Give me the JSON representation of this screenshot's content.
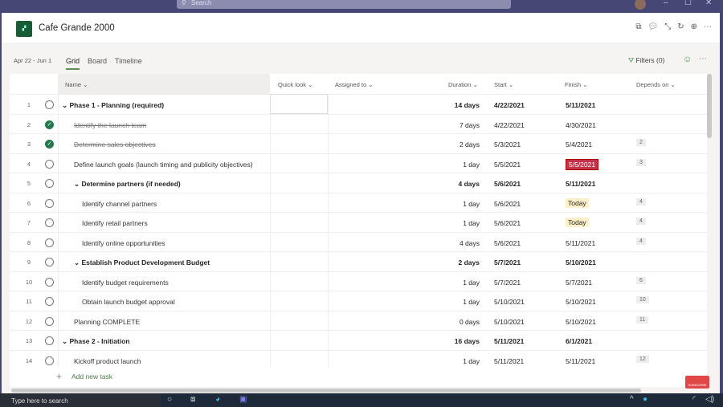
{
  "topbar": {
    "search_placeholder": "Search"
  },
  "app": {
    "title": "Cafe Grande 2000",
    "date_range": "Apr 22 - Jun 1"
  },
  "tabs": [
    {
      "label": "Grid",
      "active": true
    },
    {
      "label": "Board"
    },
    {
      "label": "Timeline"
    }
  ],
  "filters_label": "Filters (0)",
  "columns": {
    "name": "Name",
    "quick_look": "Quick look",
    "assigned_to": "Assigned to",
    "duration": "Duration",
    "start": "Start",
    "finish": "Finish",
    "depends_on": "Depends on"
  },
  "rows": [
    {
      "num": "1",
      "name": "Phase 1 - Planning (required)",
      "level": 0,
      "summary": true,
      "done": false,
      "duration": "14 days",
      "start": "4/22/2021",
      "finish": "5/11/2021",
      "depends": ""
    },
    {
      "num": "2",
      "name": "Identify the launch team",
      "level": 1,
      "done": true,
      "duration": "7 days",
      "start": "4/22/2021",
      "finish": "4/30/2021",
      "depends": ""
    },
    {
      "num": "3",
      "name": "Determine sales objectives",
      "level": 1,
      "done": true,
      "duration": "2 days",
      "start": "5/3/2021",
      "finish": "5/4/2021",
      "depends": "2"
    },
    {
      "num": "4",
      "name": "Define launch goals (launch timing and publicity objectives)",
      "level": 1,
      "done": false,
      "duration": "1 day",
      "start": "5/5/2021",
      "finish": "5/5/2021",
      "finish_status": "late",
      "depends": "3"
    },
    {
      "num": "5",
      "name": "Determine partners (if needed)",
      "level": 1,
      "summary": true,
      "done": false,
      "duration": "4 days",
      "start": "5/6/2021",
      "finish": "5/11/2021",
      "depends": ""
    },
    {
      "num": "6",
      "name": "Identify channel partners",
      "level": 2,
      "done": false,
      "duration": "1 day",
      "start": "5/6/2021",
      "finish": "Today",
      "finish_status": "today",
      "depends": "4"
    },
    {
      "num": "7",
      "name": "Identify retail partners",
      "level": 2,
      "done": false,
      "duration": "1 day",
      "start": "5/6/2021",
      "finish": "Today",
      "finish_status": "today",
      "depends": "4"
    },
    {
      "num": "8",
      "name": "Identify online opportunities",
      "level": 2,
      "done": false,
      "duration": "4 days",
      "start": "5/6/2021",
      "finish": "5/11/2021",
      "depends": "4"
    },
    {
      "num": "9",
      "name": "Establish Product Development Budget",
      "level": 1,
      "summary": true,
      "done": false,
      "duration": "2 days",
      "start": "5/7/2021",
      "finish": "5/10/2021",
      "depends": ""
    },
    {
      "num": "10",
      "name": "Identify budget requirements",
      "level": 2,
      "done": false,
      "duration": "1 day",
      "start": "5/7/2021",
      "finish": "5/7/2021",
      "depends": "6"
    },
    {
      "num": "11",
      "name": "Obtain launch budget approval",
      "level": 2,
      "done": false,
      "duration": "1 day",
      "start": "5/10/2021",
      "finish": "5/10/2021",
      "depends": "10"
    },
    {
      "num": "12",
      "name": "Planning COMPLETE",
      "level": 1,
      "done": false,
      "duration": "0 days",
      "start": "5/10/2021",
      "finish": "5/10/2021",
      "depends": "11"
    },
    {
      "num": "13",
      "name": "Phase 2 - Initiation",
      "level": 0,
      "summary": true,
      "done": false,
      "duration": "16 days",
      "start": "5/11/2021",
      "finish": "6/1/2021",
      "depends": ""
    },
    {
      "num": "14",
      "name": "Kickoff product launch",
      "level": 1,
      "done": false,
      "duration": "1 day",
      "start": "5/11/2021",
      "finish": "5/11/2021",
      "depends": "12"
    }
  ],
  "add_task_label": "Add new task",
  "subscribe_label": "SUBSCRIBE",
  "taskbar": {
    "search_placeholder": "Type here to search"
  },
  "colors": {
    "topbar": "#464775",
    "accent": "#237b4b",
    "late": "#c4314b",
    "today": "#fbf0c8"
  }
}
